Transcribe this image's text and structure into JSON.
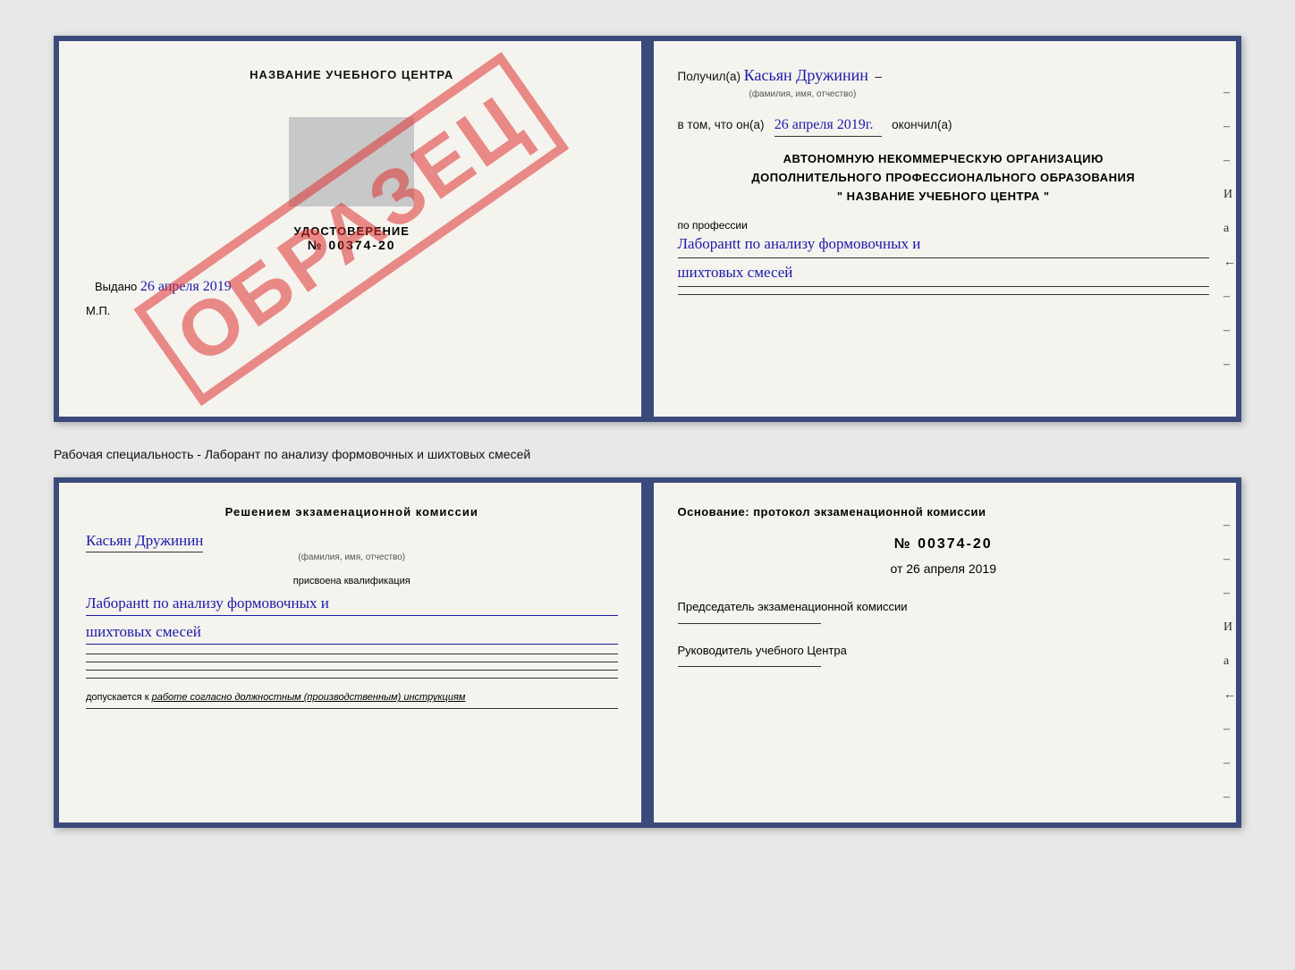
{
  "page": {
    "background": "#e8e8e8"
  },
  "top_booklet": {
    "left": {
      "title": "НАЗВАНИЕ УЧЕБНОГО ЦЕНТРА",
      "watermark": "ОБРАЗЕЦ",
      "udost_label": "УДОСТОВЕРЕНИЕ",
      "number": "№ 00374-20",
      "vydano_label": "Выдано",
      "vydano_date": "26 апреля 2019",
      "mp_label": "М.П."
    },
    "right": {
      "poluchil_label": "Получил(a)",
      "name_handwritten": "Касьян Дружинин",
      "name_sublabel": "(фамилия, имя, отчество)",
      "vtom_label": "в том, что он(a)",
      "date_handwritten": "26 апреля 2019г.",
      "okonchil_label": "окончил(а)",
      "org_line1": "АВТОНОМНУЮ НЕКОММЕРЧЕСКУЮ ОРГАНИЗАЦИЮ",
      "org_line2": "ДОПОЛНИТЕЛЬНОГО ПРОФЕССИОНАЛЬНОГО ОБРАЗОВАНИЯ",
      "org_line3": "\"  НАЗВАНИЕ УЧЕБНОГО ЦЕНТРА  \"",
      "prof_label": "по профессии",
      "prof_handwritten_1": "Лаборанtt по анализу формовочных и",
      "prof_handwritten_2": "шихтовых смесей",
      "dash_marks": [
        "-",
        "-",
        "-",
        "И",
        "а",
        "←",
        "-",
        "-",
        "-"
      ]
    }
  },
  "middle_text": "Рабочая специальность - Лаборант по анализу формовочных и шихтовых смесей",
  "bottom_booklet": {
    "left": {
      "title": "Решением  экзаменационной  комиссии",
      "name_handwritten": "Касьян  Дружинин",
      "name_sublabel": "(фамилия, имя, отчество)",
      "prisvoena_label": "присвоена квалификация",
      "qual_handwritten_1": "Лаборанtt по анализу формовочных и",
      "qual_handwritten_2": "шихтовых смесей",
      "dopuskaetsya_label": "допускается к",
      "dopuskaetsya_text": "работе согласно должностным (производственным) инструкциям"
    },
    "right": {
      "osnov_label": "Основание: протокол экзаменационной  комиссии",
      "protocol_num": "№  00374-20",
      "protocol_date_prefix": "от",
      "protocol_date": "26 апреля 2019",
      "chairman_label": "Председатель экзаменационной комиссии",
      "rukovod_label": "Руководитель учебного Центра",
      "dash_marks": [
        "-",
        "-",
        "-",
        "И",
        "а",
        "←",
        "-",
        "-",
        "-"
      ]
    }
  }
}
